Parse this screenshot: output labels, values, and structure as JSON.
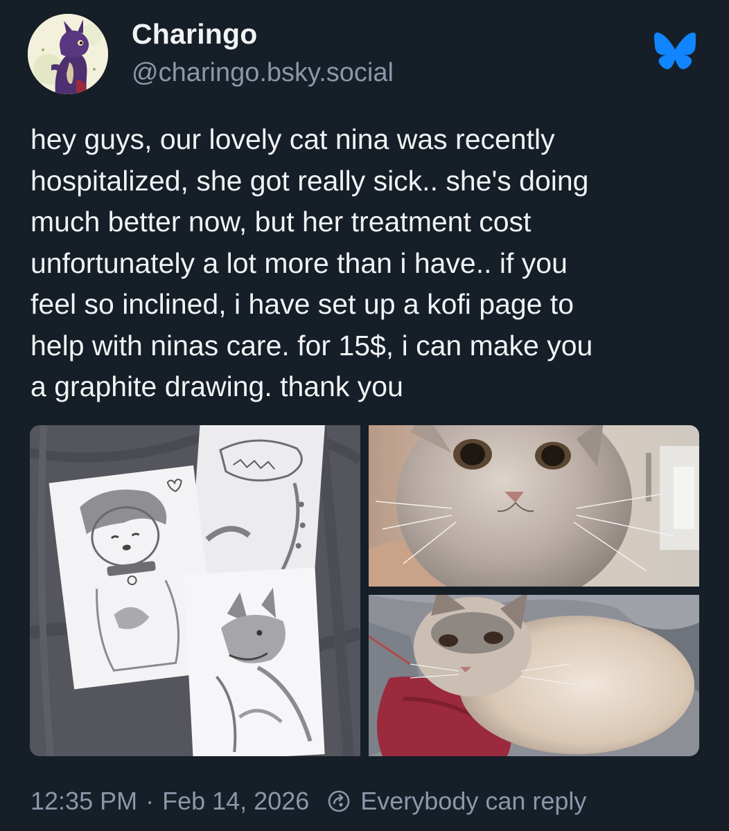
{
  "author": {
    "display_name": "Charingo",
    "handle": "@charingo.bsky.social",
    "avatar_icon": "dragon-avatar",
    "avatar_colors": {
      "background": "#f3f0dc",
      "creature": "#4e2f6f"
    }
  },
  "app": {
    "logo_icon": "bluesky-butterfly-icon",
    "brand_color": "#1185fe"
  },
  "post": {
    "text": "hey guys, our lovely cat nina was recently\nhospitalized, she got really sick.. she's doing\nmuch better now, but her treatment cost\nunfortunately a lot more than i have.. if you\nfeel so inclined, i have set up a kofi page to\nhelp with ninas care. for 15$, i can make you\na graphite drawing. thank you"
  },
  "media": [
    {
      "icon": "graphite-drawings-photo"
    },
    {
      "icon": "cat-closeup-photo"
    },
    {
      "icon": "cat-lying-photo"
    }
  ],
  "footer": {
    "time": "12:35 PM",
    "separator": "·",
    "date": "Feb 14, 2026",
    "reply_icon": "reply-settings-icon",
    "reply_setting": "Everybody can reply"
  },
  "colors": {
    "background": "#161e27",
    "text_primary": "#f1f3f5",
    "text_secondary": "#8a98a9"
  }
}
